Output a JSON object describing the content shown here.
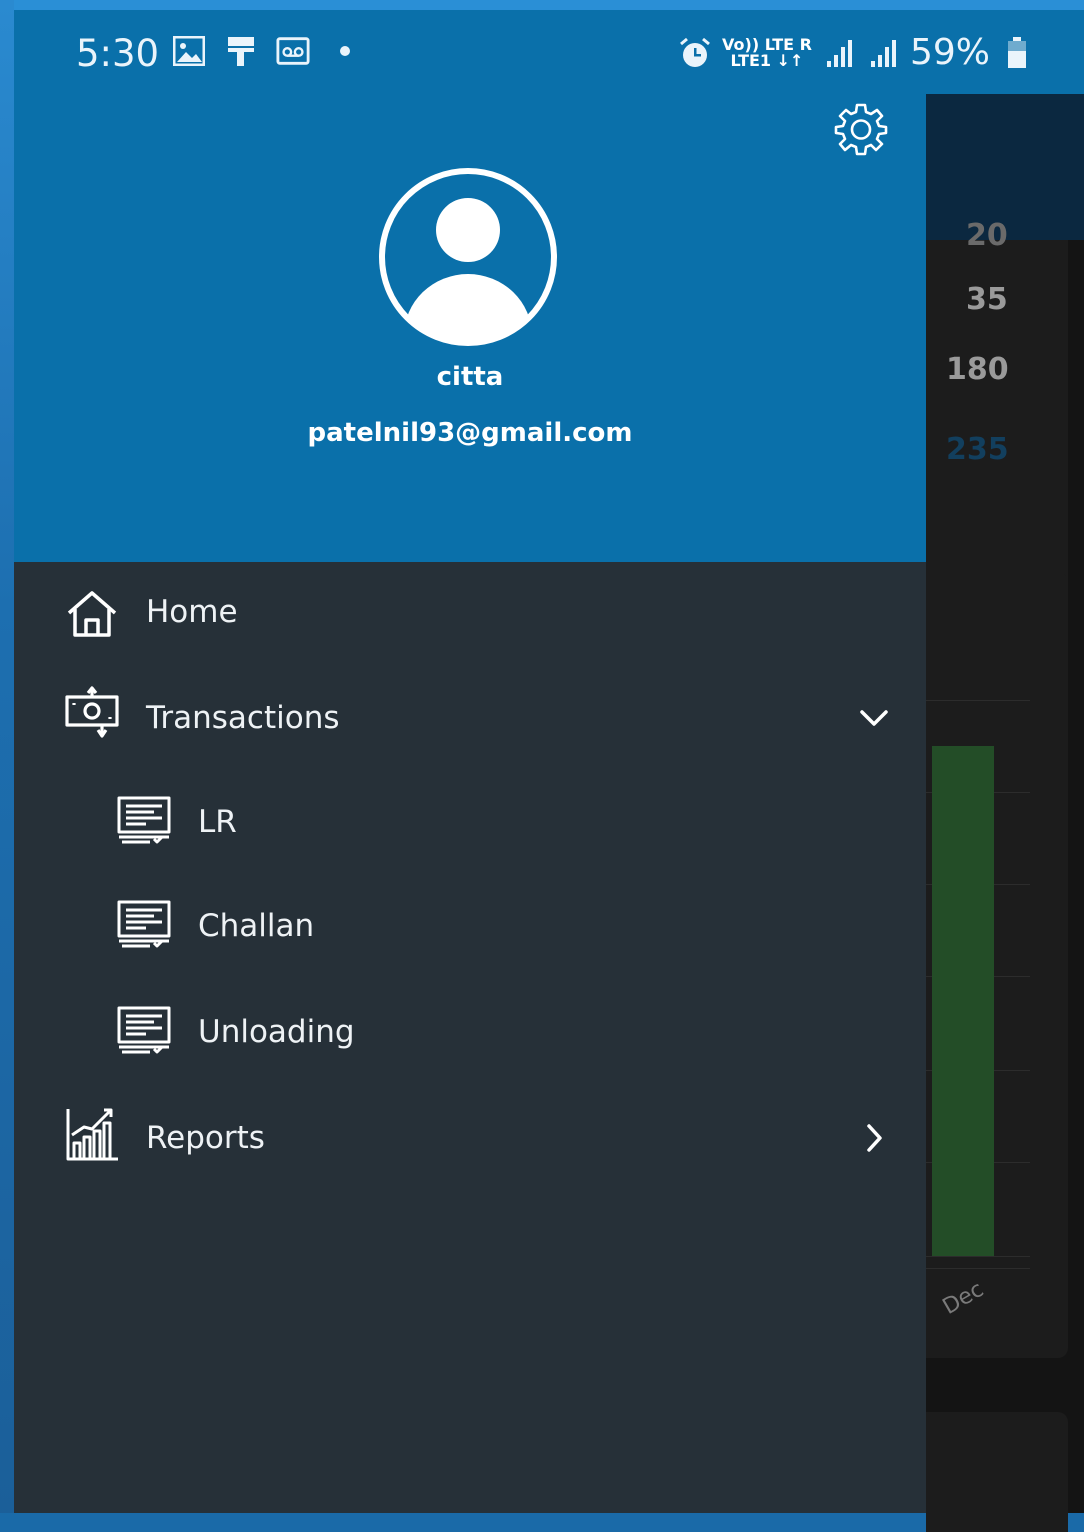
{
  "status_bar": {
    "time": "5:30",
    "left_icons": [
      "gallery-icon",
      "paint-roller-icon",
      "voicemail-icon",
      "dot-icon"
    ],
    "right_icons": [
      "alarm-icon",
      "volte-icon",
      "lte-icon",
      "signal-roaming-icon",
      "signal-icon",
      "battery-icon"
    ],
    "net_line1": "Vo)) LTE R",
    "net_line2": "LTE1 ↓↑",
    "battery": "59%"
  },
  "drawer": {
    "user": {
      "name": "citta",
      "email": "patelnil93@gmail.com"
    },
    "menu": [
      {
        "label": "Home",
        "icon": "home-icon"
      },
      {
        "label": "Transactions",
        "icon": "money-transfer-icon",
        "expanded": true
      },
      {
        "label": "LR",
        "icon": "document-list-icon",
        "sub": true
      },
      {
        "label": "Challan",
        "icon": "document-list-icon",
        "sub": true
      },
      {
        "label": "Unloading",
        "icon": "document-list-icon",
        "sub": true
      },
      {
        "label": "Reports",
        "icon": "bar-chart-icon",
        "expanded": false
      }
    ]
  },
  "background_app": {
    "values": [
      "35",
      "180",
      "235"
    ],
    "partial_value": "20",
    "bar_label": "Dec",
    "bar_color": "#234d27"
  },
  "colors": {
    "header_blue": "#0a70aa",
    "drawer_bg": "#263038",
    "value_highlight": "#123f5e"
  }
}
